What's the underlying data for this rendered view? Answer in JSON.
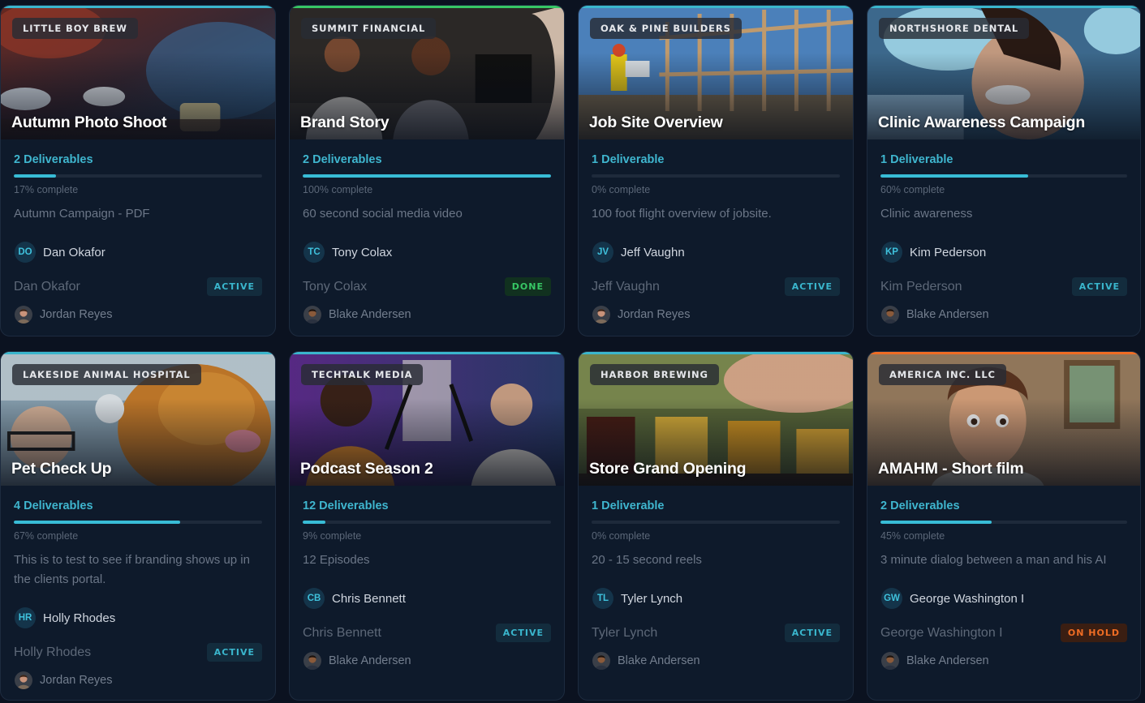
{
  "colors": {
    "accent": "#38bcd6",
    "active": "#3ab6cd",
    "done": "#37c765",
    "on_hold": "#f06d24",
    "card_bg": "#0e1a2b",
    "page_bg": "#0b1220"
  },
  "projects": [
    {
      "client": "LITTLE BOY BREW",
      "title": "Autumn Photo Shoot",
      "deliverables": "2 Deliverables",
      "progress": 0.17,
      "progress_label": "17% complete",
      "description": "Autumn Campaign - PDF",
      "owner_initials": "DO",
      "owner_name": "Dan Okafor",
      "contact": "Dan Okafor",
      "status": "ACTIVE",
      "assignee": "Jordan Reyes",
      "topbar_color": "#3ab6cd"
    },
    {
      "client": "SUMMIT FINANCIAL",
      "title": "Brand Story",
      "deliverables": "2 Deliverables",
      "progress": 1.0,
      "progress_label": "100% complete",
      "description": "60 second social media video",
      "owner_initials": "TC",
      "owner_name": "Tony Colax",
      "contact": "Tony Colax",
      "status": "DONE",
      "assignee": "Blake Andersen",
      "topbar_color": "#37c765"
    },
    {
      "client": "OAK & PINE BUILDERS",
      "title": "Job Site Overview",
      "deliverables": "1 Deliverable",
      "progress": 0.0,
      "progress_label": "0% complete",
      "description": "100 foot flight overview of jobsite.",
      "owner_initials": "JV",
      "owner_name": "Jeff Vaughn",
      "contact": "Jeff Vaughn",
      "status": "ACTIVE",
      "assignee": "Jordan Reyes",
      "topbar_color": "#3ab6cd"
    },
    {
      "client": "NORTHSHORE DENTAL",
      "title": "Clinic Awareness Campaign",
      "deliverables": "1 Deliverable",
      "progress": 0.6,
      "progress_label": "60% complete",
      "description": "Clinic awareness",
      "owner_initials": "KP",
      "owner_name": "Kim Pederson",
      "contact": "Kim Pederson",
      "status": "ACTIVE",
      "assignee": "Blake Andersen",
      "topbar_color": "#3ab6cd"
    },
    {
      "client": "LAKESIDE ANIMAL HOSPITAL",
      "title": "Pet Check Up",
      "deliverables": "4 Deliverables",
      "progress": 0.67,
      "progress_label": "67% complete",
      "description": "This is to test to see if branding shows up in the clients portal.",
      "owner_initials": "HR",
      "owner_name": "Holly Rhodes",
      "contact": "Holly Rhodes",
      "status": "ACTIVE",
      "assignee": "Jordan Reyes",
      "topbar_color": "#3ab6cd"
    },
    {
      "client": "TECHTALK MEDIA",
      "title": "Podcast Season 2",
      "deliverables": "12 Deliverables",
      "progress": 0.09,
      "progress_label": "9% complete",
      "description": "12 Episodes",
      "owner_initials": "CB",
      "owner_name": "Chris Bennett",
      "contact": "Chris Bennett",
      "status": "ACTIVE",
      "assignee": "Blake Andersen",
      "topbar_color": "#3ab6cd"
    },
    {
      "client": "HARBOR BREWING",
      "title": "Store Grand Opening",
      "deliverables": "1 Deliverable",
      "progress": 0.0,
      "progress_label": "0% complete",
      "description": "20 - 15 second reels",
      "owner_initials": "TL",
      "owner_name": "Tyler Lynch",
      "contact": "Tyler Lynch",
      "status": "ACTIVE",
      "assignee": "Blake Andersen",
      "topbar_color": "#3ab6cd"
    },
    {
      "client": "AMERICA INC. LLC",
      "title": "AMAHM - Short film",
      "deliverables": "2 Deliverables",
      "progress": 0.45,
      "progress_label": "45% complete",
      "description": "3 minute dialog between a man and his AI",
      "owner_initials": "GW",
      "owner_name": "George Washington I",
      "contact": "George Washington I",
      "status": "ON HOLD",
      "assignee": "Blake Andersen",
      "topbar_color": "#f06d24"
    }
  ]
}
